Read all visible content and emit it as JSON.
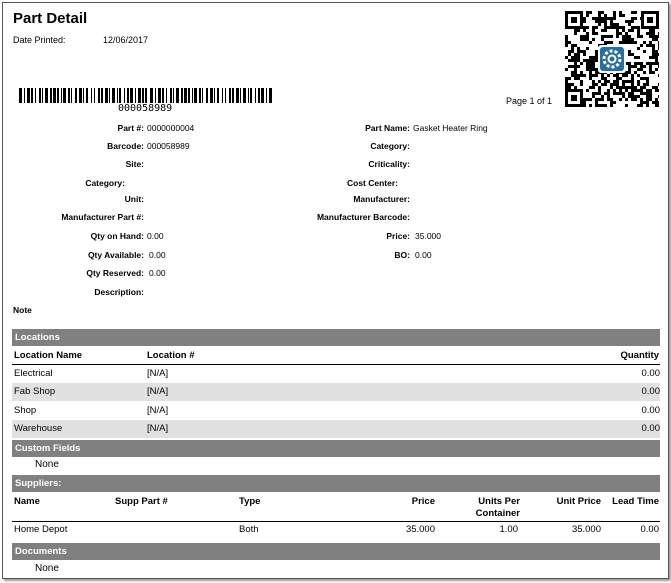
{
  "report": {
    "title": "Part Detail",
    "date_printed_label": "Date Printed:",
    "date_printed": "12/06/2017",
    "barcode_number": "000058989",
    "page_text": "Page 1 of 1"
  },
  "fields": {
    "part_no_label": "Part #:",
    "part_no": "0000000004",
    "barcode_label": "Barcode:",
    "barcode": "000058989",
    "site_label": "Site:",
    "site": "",
    "category_left_label": "Category:",
    "category_left": "",
    "unit_label": "Unit:",
    "unit": "",
    "mfr_part_label": "Manufacturer Part #:",
    "mfr_part": "",
    "qty_on_hand_label": "Qty on Hand:",
    "qty_on_hand": "0.00",
    "qty_available_label": "Qty Available:",
    "qty_available": "0.00",
    "qty_reserved_label": "Qty Reserved:",
    "qty_reserved": "0.00",
    "description_label": "Description:",
    "description": "",
    "part_name_label": "Part Name:",
    "part_name": "Gasket Heater Ring",
    "category_right_label": "Category:",
    "category_right": "",
    "criticality_label": "Criticality:",
    "criticality": "",
    "cost_center_label": "Cost Center:",
    "cost_center": "",
    "manufacturer_label": "Manufacturer:",
    "manufacturer": "",
    "mfr_barcode_label": "Manufacturer Barcode:",
    "mfr_barcode": "",
    "price_label": "Price:",
    "price": "35.000",
    "bo_label": "BO:",
    "bo": "0.00"
  },
  "note_label": "Note",
  "locations": {
    "section_title": "Locations",
    "headers": {
      "name": "Location Name",
      "number": "Location #",
      "quantity": "Quantity"
    },
    "rows": [
      {
        "name": "Electrical",
        "number": "[N/A]",
        "quantity": "0.00"
      },
      {
        "name": "Fab Shop",
        "number": "[N/A]",
        "quantity": "0.00"
      },
      {
        "name": "Shop",
        "number": "[N/A]",
        "quantity": "0.00"
      },
      {
        "name": "Warehouse",
        "number": "[N/A]",
        "quantity": "0.00"
      }
    ]
  },
  "custom_fields": {
    "section_title": "Custom Fields",
    "empty_text": "None"
  },
  "suppliers": {
    "section_title": "Suppliers:",
    "headers": {
      "name": "Name",
      "supp_part": "Supp Part #",
      "type": "Type",
      "price": "Price",
      "units_per_container": "Units Per Container",
      "unit_price": "Unit Price",
      "lead_time": "Lead Time"
    },
    "rows": [
      {
        "name": "Home Depot",
        "supp_part": "",
        "type": "Both",
        "price": "35.000",
        "units_per_container": "1.00",
        "unit_price": "35.000",
        "lead_time": "0.00"
      }
    ]
  },
  "documents": {
    "section_title": "Documents",
    "empty_text": "None"
  },
  "icons": {
    "qr": "qr-code-icon",
    "gear": "gear-icon",
    "barcode": "barcode-icon"
  },
  "colors": {
    "section_bar": "#808080",
    "alt_row": "#e1e1e1",
    "gear_badge": "#2a6f9b"
  }
}
